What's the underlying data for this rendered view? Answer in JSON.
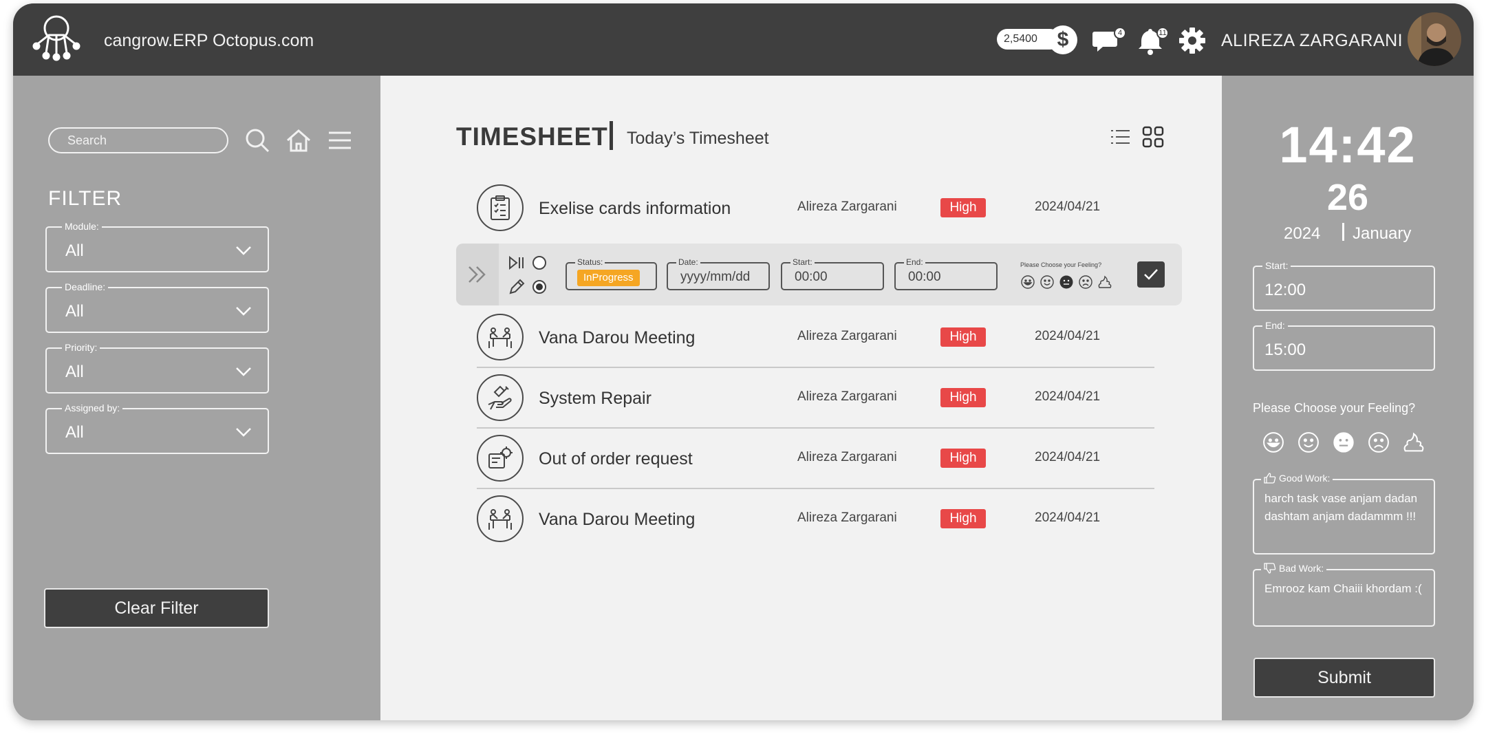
{
  "header": {
    "site_title": "cangrow.ERP Octopus.com",
    "coins": "2,5400",
    "coin_symbol": "$",
    "messages_count": "4",
    "notifications_count": "11",
    "user_name": "ALIREZA ZARGARANI"
  },
  "sidebar": {
    "search_placeholder": "Search",
    "filter_title": "FILTER",
    "filters": [
      {
        "label": "Module:",
        "value": "All"
      },
      {
        "label": "Deadline:",
        "value": "All"
      },
      {
        "label": "Priority:",
        "value": "All"
      },
      {
        "label": "Assigned by:",
        "value": "All"
      }
    ],
    "clear_label": "Clear Filter"
  },
  "main": {
    "title": "TIMESHEET",
    "subtitle": "Today’s Timesheet",
    "tasks": [
      {
        "name": "Exelise cards information",
        "assignee": "Alireza Zargarani",
        "priority": "High",
        "date": "2024/04/21",
        "icon": "clipboard-icon"
      },
      {
        "name": "Vana Darou Meeting",
        "assignee": "Alireza Zargarani",
        "priority": "High",
        "date": "2024/04/21",
        "icon": "meeting-icon"
      },
      {
        "name": "System Repair",
        "assignee": "Alireza Zargarani",
        "priority": "High",
        "date": "2024/04/21",
        "icon": "repair-icon"
      },
      {
        "name": "Out of order request",
        "assignee": "Alireza Zargarani",
        "priority": "High",
        "date": "2024/04/21",
        "icon": "request-icon"
      },
      {
        "name": "Vana Darou Meeting",
        "assignee": "Alireza Zargarani",
        "priority": "High",
        "date": "2024/04/21",
        "icon": "meeting-icon"
      }
    ],
    "detail": {
      "status_label": "Status:",
      "status_value": "InProgress",
      "date_label": "Date:",
      "date_placeholder": "yyyy/mm/dd",
      "start_label": "Start:",
      "start_value": "00:00",
      "end_label": "End:",
      "end_value": "00:00",
      "feeling_label": "Please Choose your Feeling?"
    }
  },
  "right": {
    "time": "14:42",
    "day": "26",
    "year": "2024",
    "month": "January",
    "start_label": "Start:",
    "start_value": "12:00",
    "end_label": "End:",
    "end_value": "15:00",
    "feeling_title": "Please Choose your Feeling?",
    "good_label": "Good Work:",
    "good_text": "harch task vase anjam dadan dashtam anjam dadammm !!!",
    "bad_label": "Bad Work:",
    "bad_text": "Emrooz kam Chaiii khordam :(",
    "submit_label": "Submit"
  },
  "colors": {
    "header_bg": "#3f3f3f",
    "sidebar_bg": "#a3a3a3",
    "main_bg": "#f2f2f2",
    "priority_high": "#e84848",
    "status_inprogress": "#f5a623"
  }
}
